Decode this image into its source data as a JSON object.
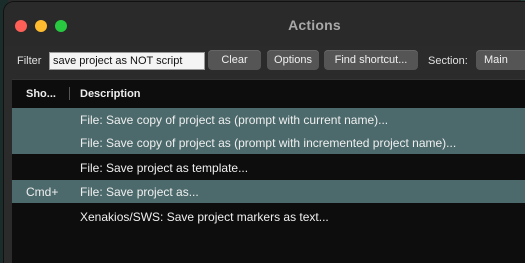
{
  "window": {
    "title": "Actions"
  },
  "toolbar": {
    "filter_label": "Filter",
    "filter_value": "save project as NOT script",
    "clear_label": "Clear",
    "options_label": "Options",
    "find_label": "Find shortcut...",
    "section_label": "Section:",
    "section_value": "Main"
  },
  "table": {
    "headers": {
      "shortcut": "Sho...",
      "description": "Description"
    },
    "rows": [
      {
        "shortcut": "",
        "description": "File: Save copy of project as (prompt with current name)...",
        "selected": true
      },
      {
        "shortcut": "",
        "description": "File: Save copy of project as (prompt with incremented project name)...",
        "selected": true
      },
      {
        "shortcut": "",
        "description": "File: Save project as template...",
        "selected": false
      },
      {
        "shortcut": "Cmd+",
        "description": "File: Save project as...",
        "selected": true
      },
      {
        "shortcut": "",
        "description": "Xenakios/SWS: Save project markers as text...",
        "selected": false
      }
    ]
  },
  "colors": {
    "selection": "#4c6a6c",
    "list_bg": "#0d0d0d",
    "window_bg": "#2b2b2b"
  }
}
